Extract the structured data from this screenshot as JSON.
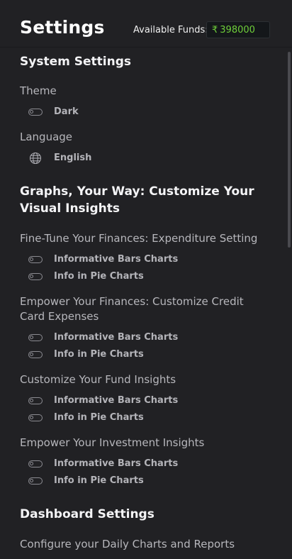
{
  "header": {
    "title": "Settings",
    "funds_label": "Available Funds:",
    "currency_symbol": "₹",
    "funds_value": "398000",
    "funds_color": "#6fcf3a"
  },
  "system": {
    "heading": "System Settings",
    "theme_label": "Theme",
    "theme_value": "Dark",
    "language_label": "Language",
    "language_value": "English",
    "language_icon": "globe-icon"
  },
  "graphs": {
    "heading": "Graphs, Your Way: Customize Your Visual Insights",
    "sections": [
      {
        "title": "Fine-Tune Your Finances: Expenditure Setting",
        "options": [
          "Informative Bars Charts",
          "Info in Pie Charts"
        ]
      },
      {
        "title": "Empower Your Finances: Customize Credit Card Expenses",
        "options": [
          "Informative Bars Charts",
          "Info in Pie Charts"
        ]
      },
      {
        "title": "Customize Your Fund Insights",
        "options": [
          "Informative Bars Charts",
          "Info in Pie Charts"
        ]
      },
      {
        "title": "Empower Your Investment Insights",
        "options": [
          "Informative Bars Charts",
          "Info in Pie Charts"
        ]
      }
    ]
  },
  "dashboard": {
    "heading": "Dashboard Settings",
    "subheading": "Configure your Daily Charts and Reports"
  }
}
